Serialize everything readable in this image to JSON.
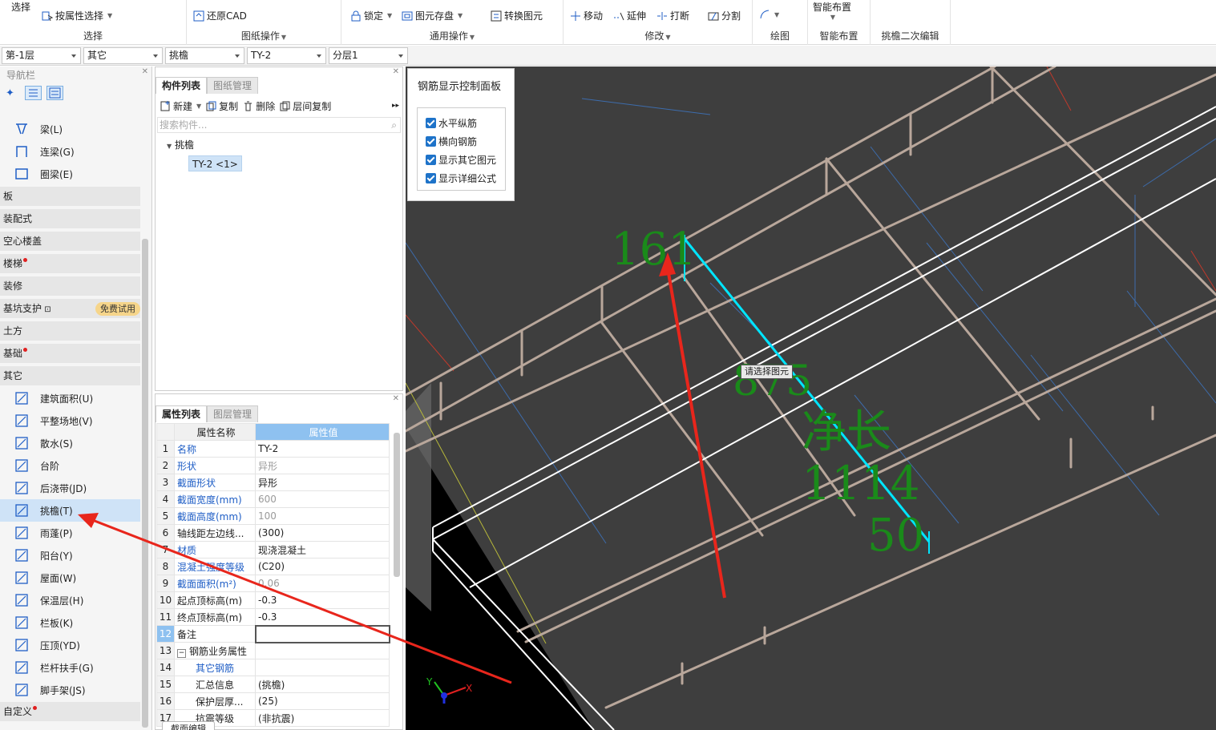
{
  "ribbon": {
    "select_main": "选择",
    "by_attr_select": "按属性选择",
    "restore_cad": "还原CAD",
    "lock": "锁定",
    "element_save": "图元存盘",
    "convert_element": "转换图元",
    "move": "移动",
    "extend": "延伸",
    "break": "打断",
    "split": "分割",
    "smart_layout_top": "智能布置",
    "groups": {
      "select": "选择",
      "drawing_ops": "图纸操作",
      "general_ops": "通用操作",
      "modify": "修改",
      "draw": "绘图",
      "smart_layout": "智能布置",
      "eave_edit": "挑檐二次编辑"
    }
  },
  "dropdowns": [
    "第-1层",
    "其它",
    "挑檐",
    "TY-2",
    "分层1"
  ],
  "nav": {
    "title": "导航栏",
    "items_top": [
      {
        "label": "梁(L)",
        "icon": "beam-icon"
      },
      {
        "label": "连梁(G)",
        "icon": "coupling-beam-icon"
      },
      {
        "label": "圈梁(E)",
        "icon": "ring-beam-icon"
      }
    ],
    "categories": [
      {
        "label": "板",
        "dot": false
      },
      {
        "label": "装配式",
        "dot": false
      },
      {
        "label": "空心楼盖",
        "dot": false
      },
      {
        "label": "楼梯",
        "dot": true
      },
      {
        "label": "装修",
        "dot": false
      },
      {
        "label": "基坑支护",
        "dot": false,
        "badge": "免费试用"
      },
      {
        "label": "土方",
        "dot": false
      },
      {
        "label": "基础",
        "dot": true
      },
      {
        "label": "其它",
        "dot": false
      }
    ],
    "items_other": [
      {
        "label": "建筑面积(U)",
        "icon": "building-area-icon"
      },
      {
        "label": "平整场地(V)",
        "icon": "site-leveling-icon"
      },
      {
        "label": "散水(S)",
        "icon": "apron-icon"
      },
      {
        "label": "台阶",
        "icon": "steps-icon"
      },
      {
        "label": "后浇带(JD)",
        "icon": "post-pour-strip-icon"
      },
      {
        "label": "挑檐(T)",
        "icon": "eave-icon",
        "selected": true
      },
      {
        "label": "雨蓬(P)",
        "icon": "canopy-icon"
      },
      {
        "label": "阳台(Y)",
        "icon": "balcony-icon"
      },
      {
        "label": "屋面(W)",
        "icon": "roof-icon"
      },
      {
        "label": "保温层(H)",
        "icon": "insulation-icon"
      },
      {
        "label": "栏板(K)",
        "icon": "parapet-icon"
      },
      {
        "label": "压顶(YD)",
        "icon": "coping-icon"
      },
      {
        "label": "栏杆扶手(G)",
        "icon": "railing-icon"
      },
      {
        "label": "脚手架(JS)",
        "icon": "scaffold-icon"
      }
    ],
    "custom": "自定义"
  },
  "components": {
    "tab_list": "构件列表",
    "tab_drawing": "图纸管理",
    "toolbar": {
      "new": "新建",
      "copy": "复制",
      "delete": "删除",
      "floor_copy": "层间复制"
    },
    "search_placeholder": "搜索构件...",
    "tree_root": "挑檐",
    "tree_item": "TY-2 <1>"
  },
  "properties": {
    "tab_list": "属性列表",
    "tab_layers": "图层管理",
    "header_name": "属性名称",
    "header_value": "属性值",
    "rows": [
      {
        "n": "1",
        "name": "名称",
        "value": "TY-2",
        "name_style": "blue",
        "value_style": ""
      },
      {
        "n": "2",
        "name": "形状",
        "value": "异形",
        "name_style": "blue",
        "value_style": "gray"
      },
      {
        "n": "3",
        "name": "截面形状",
        "value": "异形",
        "name_style": "blue",
        "value_style": ""
      },
      {
        "n": "4",
        "name": "截面宽度(mm)",
        "value": "600",
        "name_style": "blue",
        "value_style": "gray"
      },
      {
        "n": "5",
        "name": "截面高度(mm)",
        "value": "100",
        "name_style": "blue",
        "value_style": "gray"
      },
      {
        "n": "6",
        "name": "轴线距左边线...",
        "value": "(300)",
        "name_style": "",
        "value_style": ""
      },
      {
        "n": "7",
        "name": "材质",
        "value": "现浇混凝土",
        "name_style": "blue",
        "value_style": ""
      },
      {
        "n": "8",
        "name": "混凝土强度等级",
        "value": "(C20)",
        "name_style": "blue",
        "value_style": ""
      },
      {
        "n": "9",
        "name": "截面面积(m²)",
        "value": "0.06",
        "name_style": "blue",
        "value_style": "gray"
      },
      {
        "n": "10",
        "name": "起点顶标高(m)",
        "value": "-0.3",
        "name_style": "",
        "value_style": ""
      },
      {
        "n": "11",
        "name": "终点顶标高(m)",
        "value": "-0.3",
        "name_style": "",
        "value_style": ""
      },
      {
        "n": "12",
        "name": "备注",
        "value": "",
        "name_style": "",
        "value_style": ""
      },
      {
        "n": "13",
        "name": "钢筋业务属性",
        "value": "",
        "name_style": "",
        "value_style": ""
      },
      {
        "n": "14",
        "name": "其它钢筋",
        "value": "",
        "name_style": "blue",
        "value_style": ""
      },
      {
        "n": "15",
        "name": "汇总信息",
        "value": "(挑檐)",
        "name_style": "",
        "value_style": ""
      },
      {
        "n": "16",
        "name": "保护层厚...",
        "value": "(25)",
        "name_style": "",
        "value_style": ""
      },
      {
        "n": "17",
        "name": "抗震等级",
        "value": "(非抗震)",
        "name_style": "",
        "value_style": ""
      }
    ],
    "bottom_tab": "截面编辑"
  },
  "control_panel": {
    "title": "钢筋显示控制面板",
    "options": [
      "水平纵筋",
      "横向钢筋",
      "显示其它图元",
      "显示详细公式"
    ]
  },
  "viewport": {
    "tooltip": "请选择图元",
    "dim_161": "161",
    "dim_875": "875",
    "dim_net": "净长",
    "dim_1114": "1114",
    "dim_50": "50",
    "axis_x": "X",
    "axis_y": "Y"
  },
  "colors": {
    "rebar_highlight": "#00e5ff",
    "dim_green": "#1a8a1a",
    "annotation_arrow": "#e8261c",
    "beam_lines": "#b9a79b"
  }
}
